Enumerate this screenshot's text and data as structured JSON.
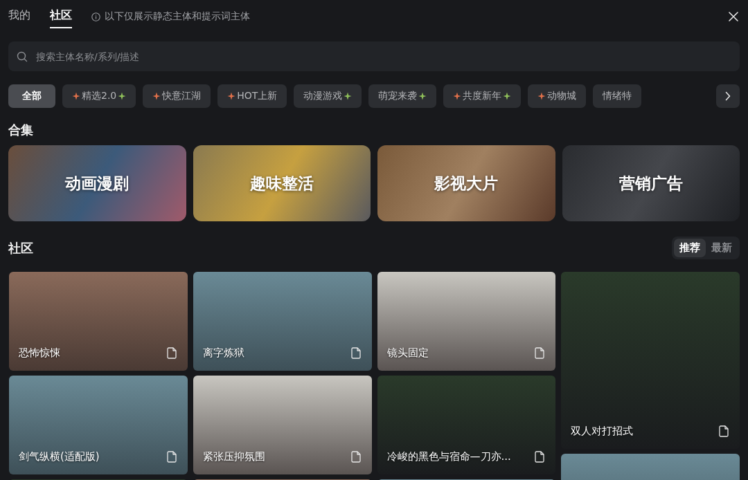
{
  "tabs": [
    {
      "label": "我的",
      "selected": false
    },
    {
      "label": "社区",
      "selected": true
    }
  ],
  "notice": "以下仅展示静态主体和提示词主体",
  "search": {
    "placeholder": "搜索主体名称/系列/描述"
  },
  "filters": [
    {
      "label": "全部",
      "selected": true,
      "icon_before": false,
      "icon_after": false
    },
    {
      "label": "精选2.0",
      "selected": false,
      "icon_before": true,
      "icon_after": true
    },
    {
      "label": "快意江湖",
      "selected": false,
      "icon_before": true,
      "icon_after": false
    },
    {
      "label": "HOT上新",
      "selected": false,
      "icon_before": true,
      "icon_after": false
    },
    {
      "label": "动漫游戏",
      "selected": false,
      "icon_before": false,
      "icon_after": true
    },
    {
      "label": "萌宠来袭",
      "selected": false,
      "icon_before": false,
      "icon_after": true
    },
    {
      "label": "共度新年",
      "selected": false,
      "icon_before": true,
      "icon_after": true
    },
    {
      "label": "动物城",
      "selected": false,
      "icon_before": true,
      "icon_after": false
    },
    {
      "label": "情绪特",
      "selected": false,
      "icon_before": false,
      "icon_after": false
    }
  ],
  "collections": {
    "title": "合集",
    "items": [
      "动画漫剧",
      "趣味整活",
      "影视大片",
      "营销广告"
    ]
  },
  "community": {
    "title": "社区",
    "sort": [
      {
        "label": "推荐",
        "selected": true
      },
      {
        "label": "最新",
        "selected": false
      }
    ],
    "columns": [
      [
        {
          "kind": "titled",
          "title": "恐怖惊悚"
        },
        {
          "kind": "titled",
          "title": "剑气纵横(适配版)"
        },
        {
          "kind": "photo"
        }
      ],
      [
        {
          "kind": "titled",
          "title": "离字炼狱"
        },
        {
          "kind": "titled",
          "title": "紧张压抑氛围"
        },
        {
          "kind": "photo"
        }
      ],
      [
        {
          "kind": "titled",
          "title": "镜头固定"
        },
        {
          "kind": "titled",
          "title": "冷峻的黑色与宿命—刀亦..."
        },
        {
          "kind": "photo"
        }
      ],
      [
        {
          "kind": "tall",
          "title": "双人对打招式"
        },
        {
          "kind": "photo"
        }
      ]
    ]
  }
}
